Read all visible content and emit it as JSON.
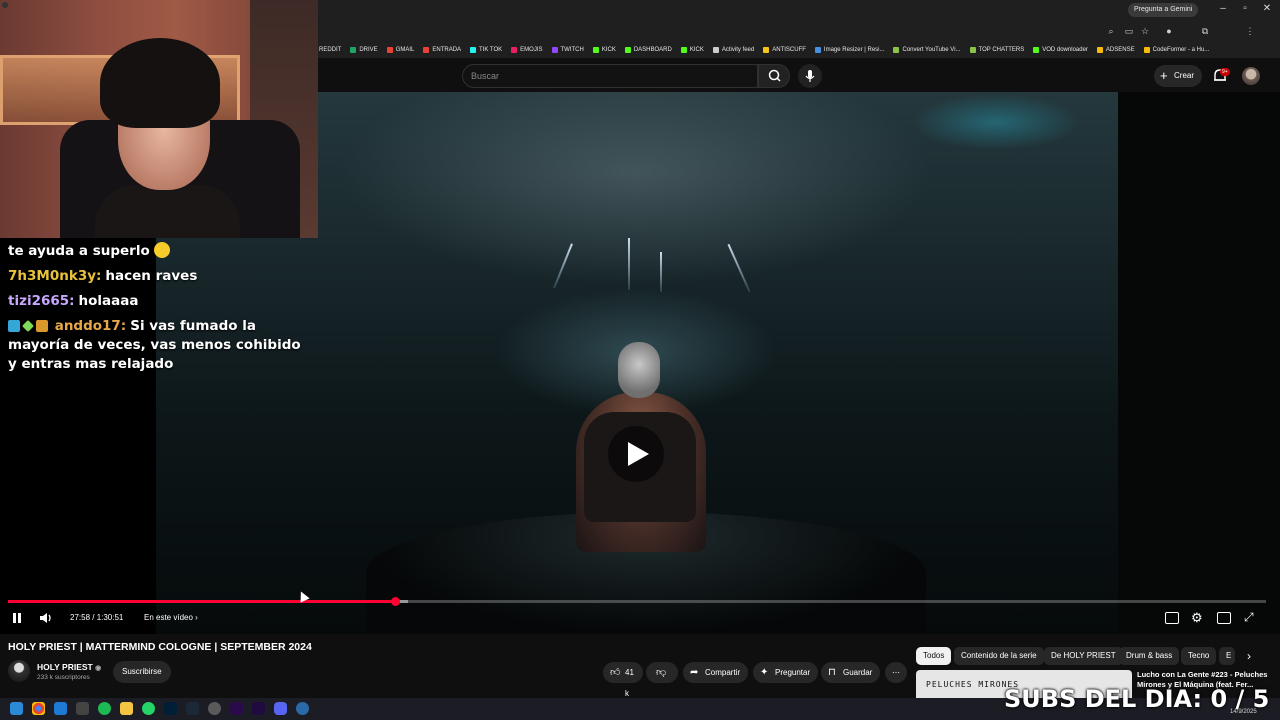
{
  "browser": {
    "gemini_label": "Pregunta a Gemini",
    "bookmarks": [
      {
        "label": "REDDIT",
        "color": "#ff4500"
      },
      {
        "label": "DRIVE",
        "color": "#1fa463"
      },
      {
        "label": "GMAIL",
        "color": "#ea4335"
      },
      {
        "label": "ENTRADA",
        "color": "#ea4335"
      },
      {
        "label": "TIK TOK",
        "color": "#25f4ee"
      },
      {
        "label": "EMOJIS",
        "color": "#e91e63"
      },
      {
        "label": "TWITCH",
        "color": "#9146ff"
      },
      {
        "label": "KICK",
        "color": "#53fc18"
      },
      {
        "label": "DASHBOARD",
        "color": "#53fc18"
      },
      {
        "label": "KICK",
        "color": "#53fc18"
      },
      {
        "label": "Activity feed",
        "color": "#cccccc"
      },
      {
        "label": "ANTISCUFF",
        "color": "#f5c518"
      },
      {
        "label": "Image Resizer | Resi...",
        "color": "#4a90e2"
      },
      {
        "label": "Convert YouTube Vi...",
        "color": "#8bc34a"
      },
      {
        "label": "TOP CHATTERS",
        "color": "#8bc34a"
      },
      {
        "label": "VOD downloader",
        "color": "#53fc18"
      },
      {
        "label": "ADSENSE",
        "color": "#fbbc05"
      },
      {
        "label": "CodeFormer - a Hu...",
        "color": "#fbbc05"
      }
    ]
  },
  "header": {
    "search_placeholder": "Buscar",
    "create_label": "Crear",
    "notif_count": "9+"
  },
  "chat": {
    "lines": [
      {
        "user": "",
        "message": "te ayuda a superlo",
        "user_color": "#ffffff"
      },
      {
        "user": "7h3M0nk3y:",
        "message": "hacen raves",
        "user_color": "#e8c23a"
      },
      {
        "user": "tizi2665:",
        "message": "holaaaa",
        "user_color": "#c7a8ff"
      },
      {
        "user": "anddo17:",
        "message": "Si vas fumado la mayoría de veces, vas menos cohibido y entras mas relajado",
        "user_color": "#e8a84a"
      }
    ]
  },
  "player": {
    "time": "27:58 / 1:30:51",
    "chapters_label": "En este vídeo",
    "progress_played": 0.308,
    "progress_buffered": 0.318,
    "accent": "#ff0033"
  },
  "video": {
    "title": "HOLY PRIEST | MATTERMIND COLOGNE | SEPTEMBER 2024",
    "channel": "HOLY PRIEST",
    "subscribers": "233 k suscriptores",
    "subscribe_label": "Suscribirse",
    "likes": "41 k",
    "share_label": "Compartir",
    "ask_label": "Preguntar",
    "save_label": "Guardar"
  },
  "chips": [
    "Todos",
    "Contenido de la serie",
    "De HOLY PRIEST",
    "Drum & bass",
    "Tecno",
    "E"
  ],
  "recommendation": {
    "thumb_text": "PELUCHES MIRONES",
    "title": "Lucho con La Gente #223 - Peluches Mirones y El Máquina (feat. Fer..."
  },
  "overlay": {
    "subs_goal": "SUBS DEL DIA: 0 / 5"
  },
  "taskbar": {
    "date": "14/9/2025"
  }
}
